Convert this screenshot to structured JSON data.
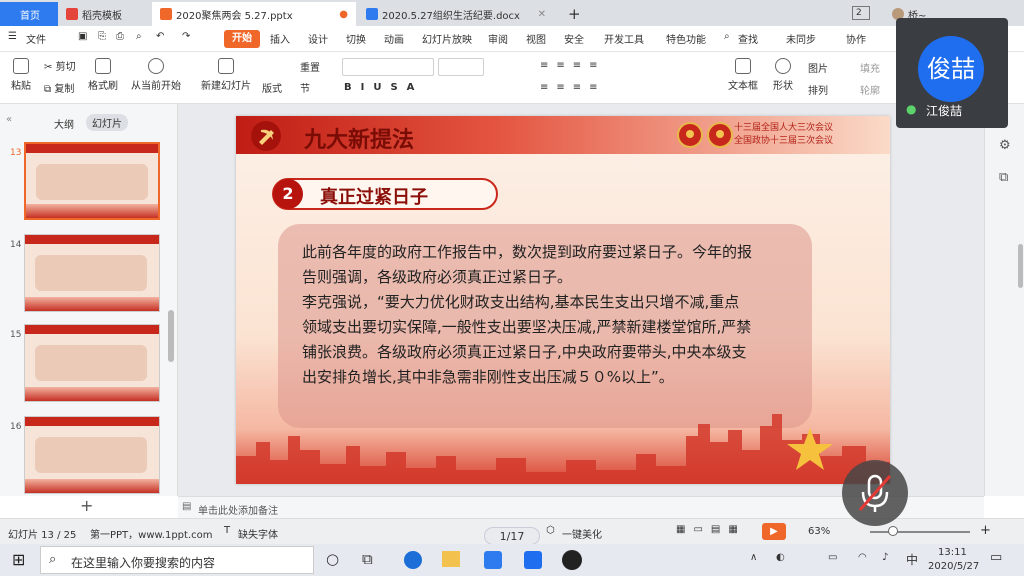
{
  "tabs": [
    {
      "label": "首页",
      "color": "#2e7bf0"
    },
    {
      "label": "稻壳模板",
      "color": "#e5443a"
    },
    {
      "label": "2020聚焦两会 5.27.pptx",
      "color": "#f0672a"
    },
    {
      "label": "2020.5.27组织生活纪要.docx",
      "color": "#2e7bf0"
    }
  ],
  "tab_counter": "2",
  "user_name_short": "桥~",
  "menu": {
    "file": "文件",
    "start": "开始",
    "items": [
      "插入",
      "设计",
      "切换",
      "动画",
      "幻灯片放映",
      "审阅",
      "视图",
      "安全",
      "开发工具",
      "特色功能"
    ],
    "search": "查找",
    "sync": "未同步",
    "collab": "协作"
  },
  "toolbar": {
    "paste": "粘贴",
    "cut": "剪切",
    "copy": "复制",
    "format_painter": "格式刷",
    "play_from_current": "从当前开始",
    "new_slide": "新建幻灯片",
    "layout": "版式",
    "section": "节",
    "reset": "重置",
    "textbox": "文本框",
    "shape": "形状",
    "arrange": "排列",
    "picture": "图片",
    "fill": "填充",
    "outline": "轮廓"
  },
  "leftpanel": {
    "tab_outline": "大纲",
    "tab_slides": "幻灯片",
    "slide_numbers": [
      "13",
      "14",
      "15",
      "16"
    ]
  },
  "slide": {
    "title": "九大新提法",
    "header_line1": "十三届全国人大三次会议",
    "header_line2": "全国政协十三届三次会议",
    "sub_number": "2",
    "subtitle": "真正过紧日子",
    "body_lines": [
      "此前各年度的政府工作报告中，数次提到政府要过紧日子。今年的报",
      "告则强调，各级政府必须真正过紧日子。",
      "李克强说，“要大力优化财政支出结构,基本民生支出只增不减,重点",
      "领域支出要切实保障,一般性支出要坚决压减,严禁新建楼堂馆所,严禁",
      "铺张浪费。各级政府必须真正过紧日子,中央政府要带头,中央本级支",
      "出安排负增长,其中非急需非刚性支出压减５０%以上”。"
    ]
  },
  "notes_placeholder": "单击此处添加备注",
  "status": {
    "slide_info": "幻灯片 13 / 25",
    "template": "第一PPT，www.1ppt.com",
    "missing_font": "缺失字体",
    "beautify": "一键美化",
    "zoom": "63%"
  },
  "page_badge": "1/17",
  "video": {
    "avatar_text": "俊喆",
    "name": "江俊喆"
  },
  "taskbar": {
    "search_placeholder": "在这里输入你要搜索的内容",
    "time": "13:11",
    "date": "2020/5/27",
    "ime": "中"
  }
}
